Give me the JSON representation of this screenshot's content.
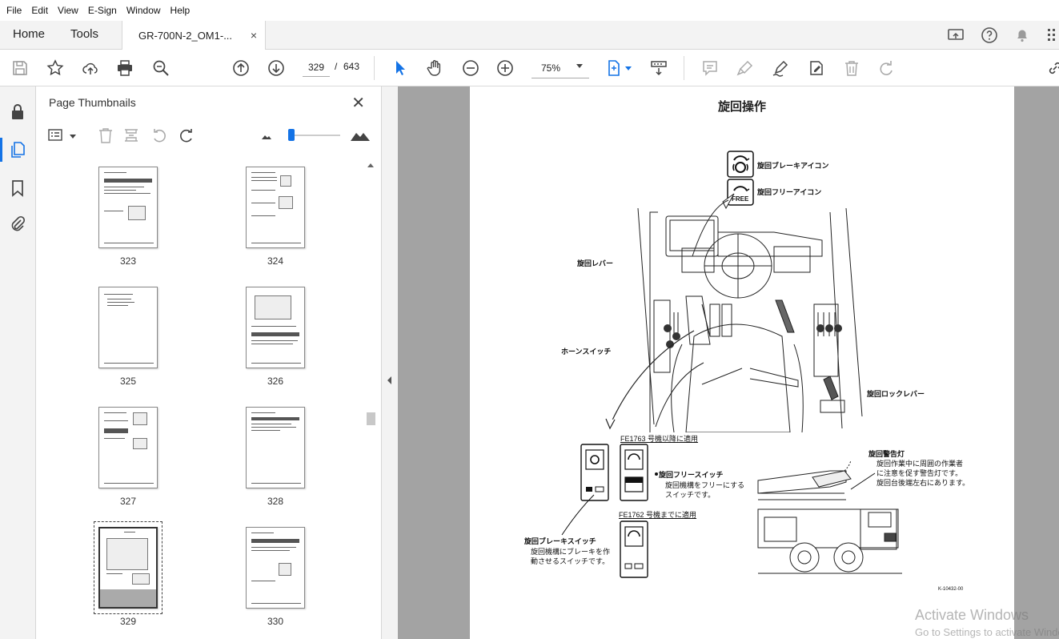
{
  "menu": [
    "File",
    "Edit",
    "View",
    "E-Sign",
    "Window",
    "Help"
  ],
  "tabs": {
    "home": "Home",
    "tools": "Tools",
    "document": "GR-700N-2_OM1-...",
    "close": "×"
  },
  "toolbar": {
    "page_current": "329",
    "page_sep": "/",
    "page_total": "643",
    "zoom": "75%"
  },
  "thumbnails_panel": {
    "title": "Page Thumbnails",
    "close": "✕",
    "pages": [
      "323",
      "324",
      "325",
      "326",
      "327",
      "328",
      "329",
      "330"
    ],
    "selected": "329"
  },
  "document": {
    "title": "旋回操作",
    "labels": {
      "brake_icon": "旋回ブレーキアイコン",
      "free_icon": "旋回フリーアイコン",
      "free_text": "FREE",
      "lever": "旋回レバー",
      "horn": "ホーンスイッチ",
      "lock_lever": "旋回ロックレバー",
      "applies_after": "FE1763 号機以降に適用",
      "free_switch": "旋回フリースイッチ",
      "free_switch_desc1": "旋回機構をフリーにする",
      "free_switch_desc2": "スイッチです。",
      "applies_before": "FE1762 号機までに適用",
      "brake_switch": "旋回ブレーキスイッチ",
      "brake_switch_desc1": "旋回機構にブレーキを作",
      "brake_switch_desc2": "動させるスイッチです。",
      "warning_light": "旋回警告灯",
      "warning_desc1": "旋回作業中に周囲の作業者",
      "warning_desc2": "に注意を促す警告灯です。",
      "warning_desc3": "旋回台後端左右にあります。",
      "figure_code": "K-10432-00"
    }
  },
  "os_watermark": {
    "line1": "Activate Windows",
    "line2": "Go to Settings to activate Windows."
  },
  "colors": {
    "accent": "#1473e6",
    "viewport_bg": "#a3a3a3",
    "panel_bg": "#f3f3f3"
  }
}
